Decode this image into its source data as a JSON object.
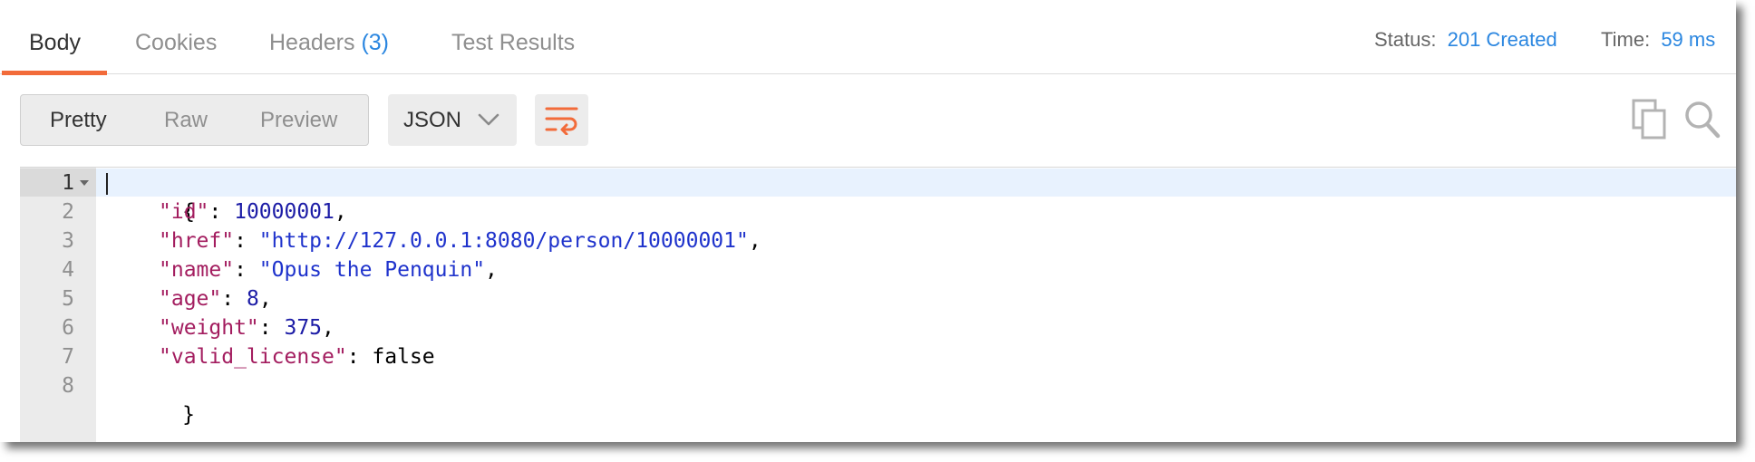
{
  "tabs": [
    {
      "label": "Body",
      "active": true
    },
    {
      "label": "Cookies",
      "active": false
    },
    {
      "label": "Headers",
      "count": "(3)",
      "active": false
    },
    {
      "label": "Test Results",
      "active": false
    }
  ],
  "status": {
    "status_label": "Status:",
    "status_value": "201 Created",
    "time_label": "Time:",
    "time_value": "59 ms"
  },
  "toolbar": {
    "modes": [
      {
        "label": "Pretty",
        "active": true
      },
      {
        "label": "Raw",
        "active": false
      },
      {
        "label": "Preview",
        "active": false
      }
    ],
    "format": "JSON",
    "icons": {
      "format_dropdown": "chevron-down-icon",
      "wrap": "wrap-lines-icon",
      "copy": "copy-icon",
      "search": "search-icon"
    }
  },
  "colors": {
    "accent": "#f26b3a",
    "link": "#2a86e0",
    "json_key": "#a31d5f",
    "json_number": "#1c1ca6",
    "json_string": "#1f33cc",
    "active_line": "#e8f2fe"
  },
  "editor": {
    "lines": [
      {
        "number": "1",
        "open_brace": "{"
      },
      {
        "number": "2",
        "key": "\"id\"",
        "sep": ": ",
        "value": "10000001",
        "type": "num",
        "comma": ","
      },
      {
        "number": "3",
        "key": "\"href\"",
        "sep": ": ",
        "value": "\"http://127.0.0.1:8080/person/10000001\"",
        "type": "str",
        "comma": ","
      },
      {
        "number": "4",
        "key": "\"name\"",
        "sep": ": ",
        "value": "\"Opus the Penquin\"",
        "type": "str",
        "comma": ","
      },
      {
        "number": "5",
        "key": "\"age\"",
        "sep": ": ",
        "value": "8",
        "type": "num",
        "comma": ","
      },
      {
        "number": "6",
        "key": "\"weight\"",
        "sep": ": ",
        "value": "375",
        "type": "num",
        "comma": ","
      },
      {
        "number": "7",
        "key": "\"valid_license\"",
        "sep": ": ",
        "value": "false",
        "type": "lit",
        "comma": ""
      },
      {
        "number": "8",
        "close_brace": "}"
      }
    ]
  }
}
